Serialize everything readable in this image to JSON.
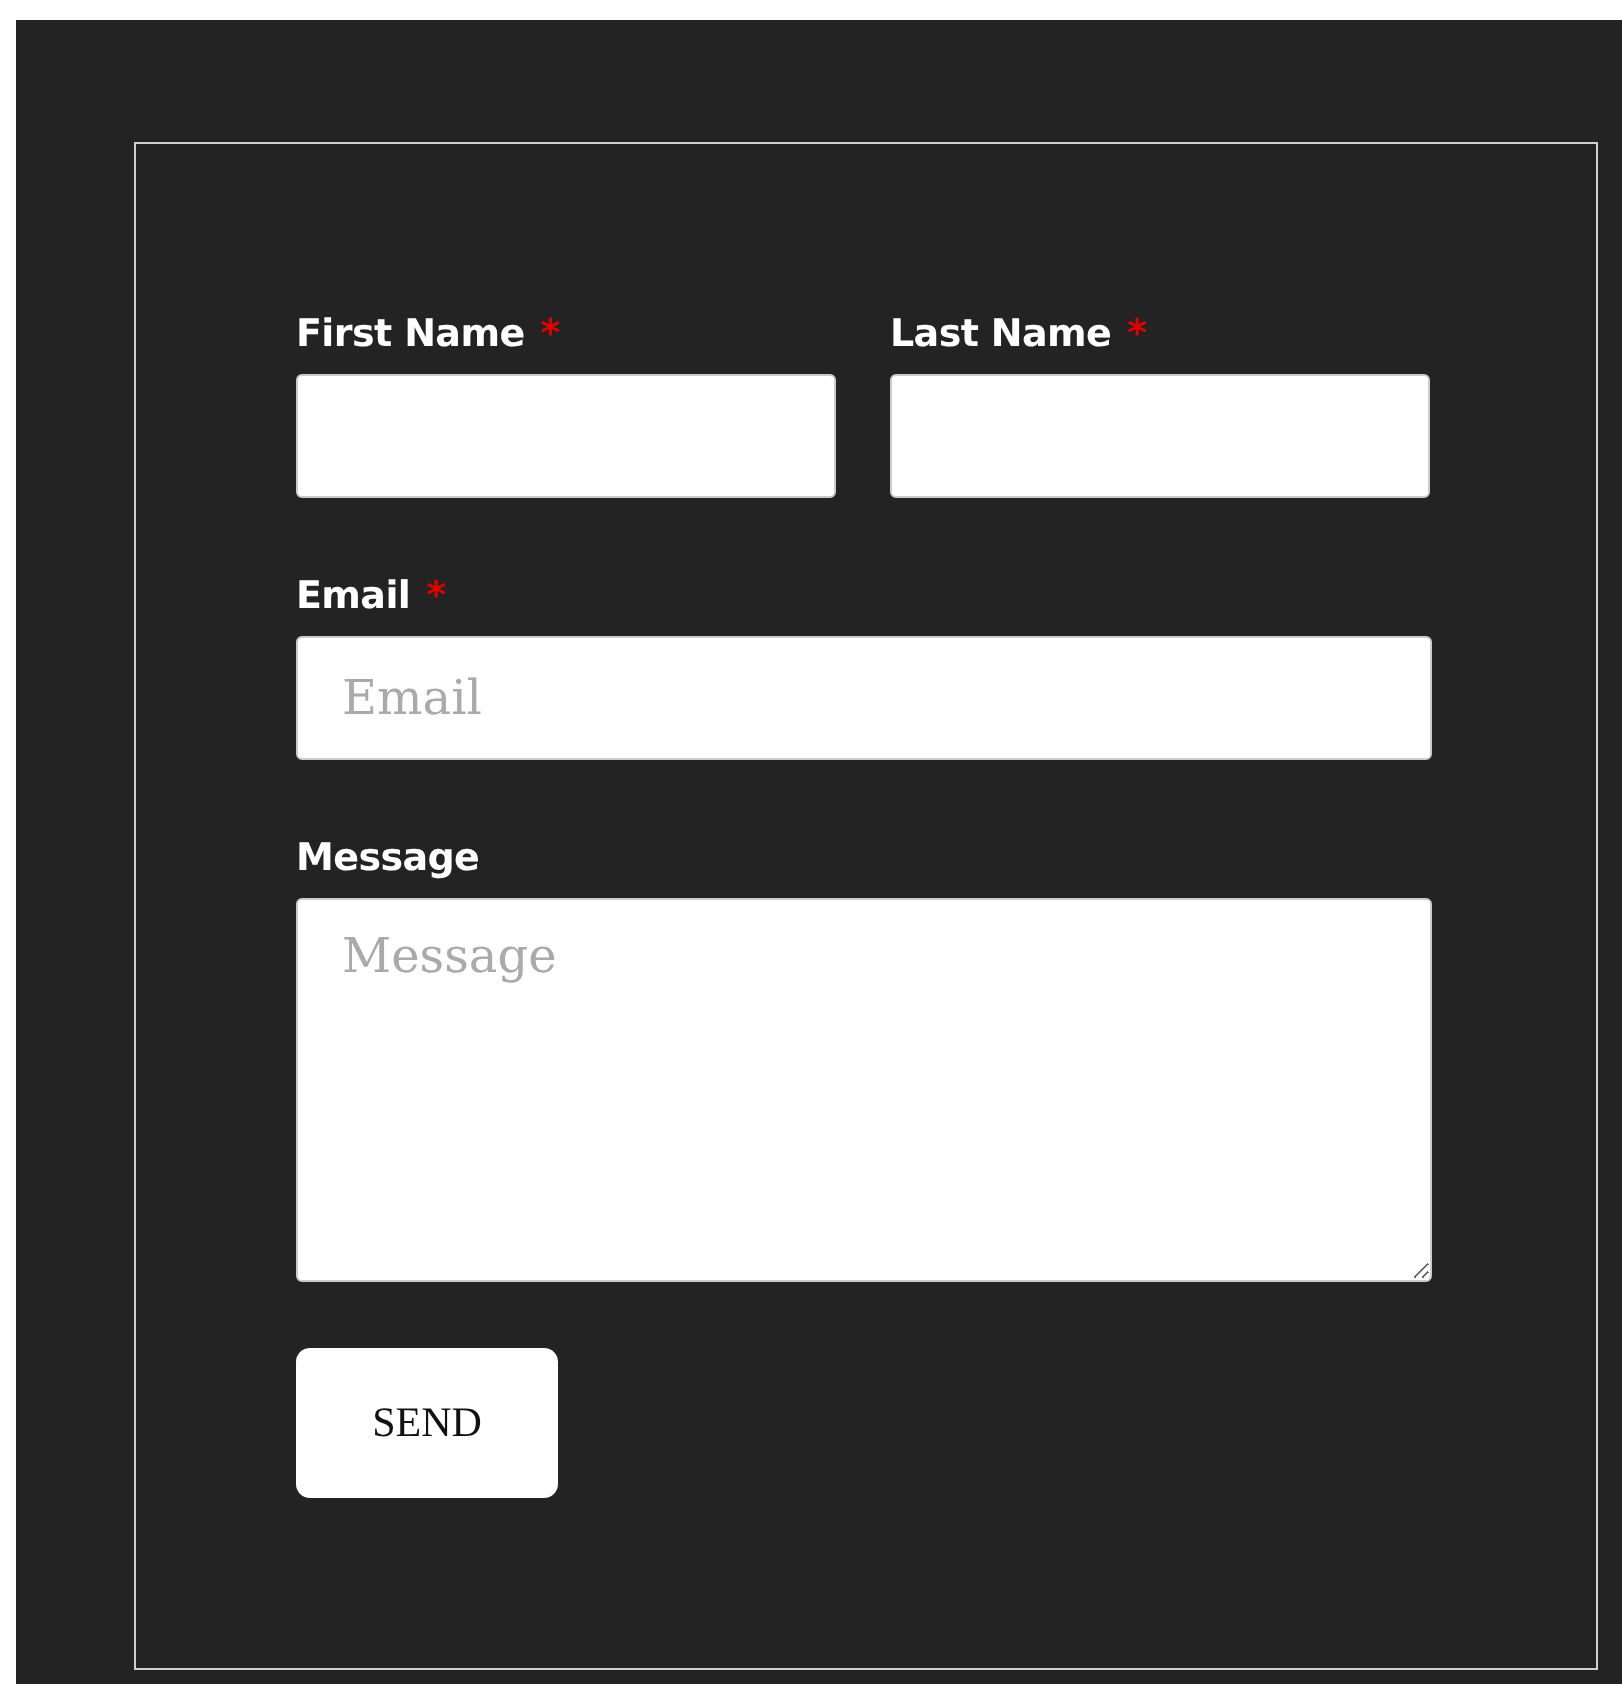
{
  "form": {
    "fields": [
      {
        "kind": "text",
        "label": "First Name",
        "required_mark": "*"
      },
      {
        "kind": "text",
        "label": "Last Name",
        "required_mark": "*"
      },
      {
        "kind": "email",
        "label": "Email",
        "required_mark": "*",
        "placeholder": "Email"
      },
      {
        "kind": "textarea",
        "label": "Message",
        "placeholder": "Message"
      }
    ],
    "submit": "SEND"
  }
}
